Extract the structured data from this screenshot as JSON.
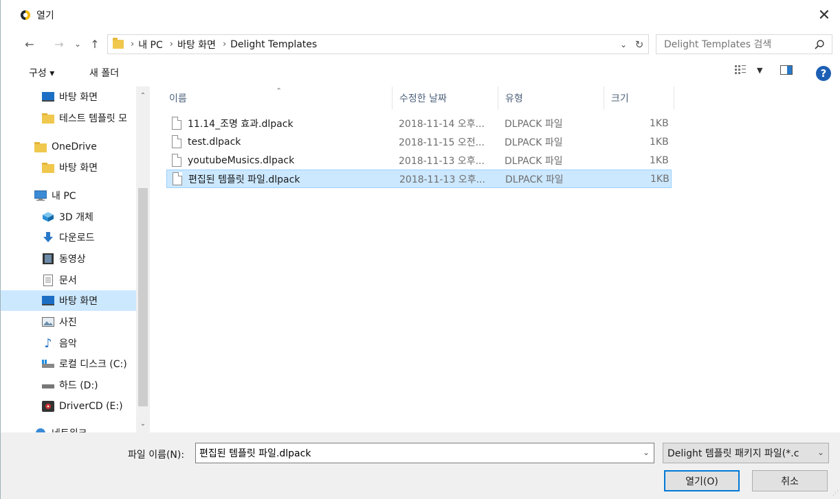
{
  "window": {
    "title": "열기"
  },
  "nav": {
    "back": "←",
    "forward": "→",
    "recent": "⌄",
    "up": "↑"
  },
  "address": {
    "crumbs": [
      "내 PC",
      "바탕 화면",
      "Delight Templates"
    ],
    "separator": "›"
  },
  "search": {
    "placeholder": "Delight Templates 검색"
  },
  "toolbar": {
    "organize": "구성 ▾",
    "new_folder": "새 폴더",
    "help": "?"
  },
  "sidebar": {
    "items": [
      {
        "label": "바탕 화면",
        "icon": "desktop-icon"
      },
      {
        "label": "테스트 템플릿 모",
        "icon": "folder-icon"
      },
      {
        "label": "OneDrive",
        "icon": "folder-icon"
      },
      {
        "label": "바탕 화면",
        "icon": "folder-icon"
      },
      {
        "label": "내 PC",
        "icon": "pc-icon"
      },
      {
        "label": "3D 개체",
        "icon": "3d-objects-icon"
      },
      {
        "label": "다운로드",
        "icon": "download-icon"
      },
      {
        "label": "동영상",
        "icon": "video-icon"
      },
      {
        "label": "문서",
        "icon": "document-icon"
      },
      {
        "label": "바탕 화면",
        "icon": "desktop-icon"
      },
      {
        "label": "사진",
        "icon": "picture-icon"
      },
      {
        "label": "음악",
        "icon": "music-icon"
      },
      {
        "label": "로컬 디스크 (C:)",
        "icon": "local-disk-icon"
      },
      {
        "label": "하드 (D:)",
        "icon": "drive-icon"
      },
      {
        "label": "DriverCD (E:)",
        "icon": "cd-drive-icon"
      },
      {
        "label": "네트워크",
        "icon": "network-icon"
      }
    ],
    "selected_index": 9
  },
  "columns": {
    "name": "이름",
    "date": "수정한 날짜",
    "type": "유형",
    "size": "크기"
  },
  "files": [
    {
      "name": "11.14_조명 효과.dlpack",
      "date": "2018-11-14 오후...",
      "type": "DLPACK 파일",
      "size": "1KB"
    },
    {
      "name": "test.dlpack",
      "date": "2018-11-15 오전...",
      "type": "DLPACK 파일",
      "size": "1KB"
    },
    {
      "name": "youtubeMusics.dlpack",
      "date": "2018-11-13 오후...",
      "type": "DLPACK 파일",
      "size": "1KB"
    },
    {
      "name": "편집된 템플릿 파일.dlpack",
      "date": "2018-11-13 오후...",
      "type": "DLPACK 파일",
      "size": "1KB"
    }
  ],
  "selected_file_index": 3,
  "footer": {
    "filename_label": "파일 이름(N):",
    "filename_value": "편집된 템플릿 파일.dlpack",
    "filetype": "Delight 템플릿 패키지 파일(*.c",
    "open_button": "열기(O)",
    "cancel_button": "취소"
  },
  "colors": {
    "selection": "#cce8ff",
    "selection_border": "#99d1ff",
    "primary_border": "#0078d7",
    "help_blue": "#1c5fb4",
    "folder_yellow": "#f0c84e"
  }
}
